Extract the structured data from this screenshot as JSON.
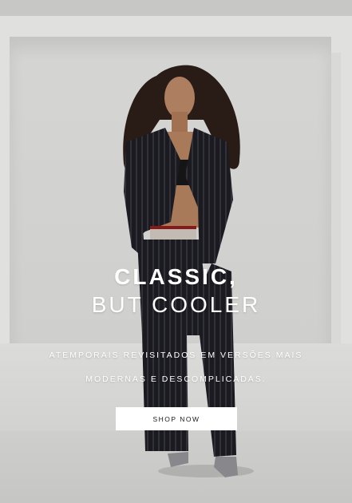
{
  "hero": {
    "headline_line1": "CLASSIC,",
    "headline_line2": "BUT COOLER",
    "subtext_line1": "ATEMPORAIS REVISITADOS EM VERSÕES MAIS",
    "subtext_line2": "MODERNAS E DESCOMPLICADAS.",
    "cta_label": "SHOP NOW"
  },
  "colors": {
    "text": "#ffffff",
    "button_bg": "#ffffff",
    "button_text": "#1a1a1a",
    "background": "#e2e2e0"
  }
}
